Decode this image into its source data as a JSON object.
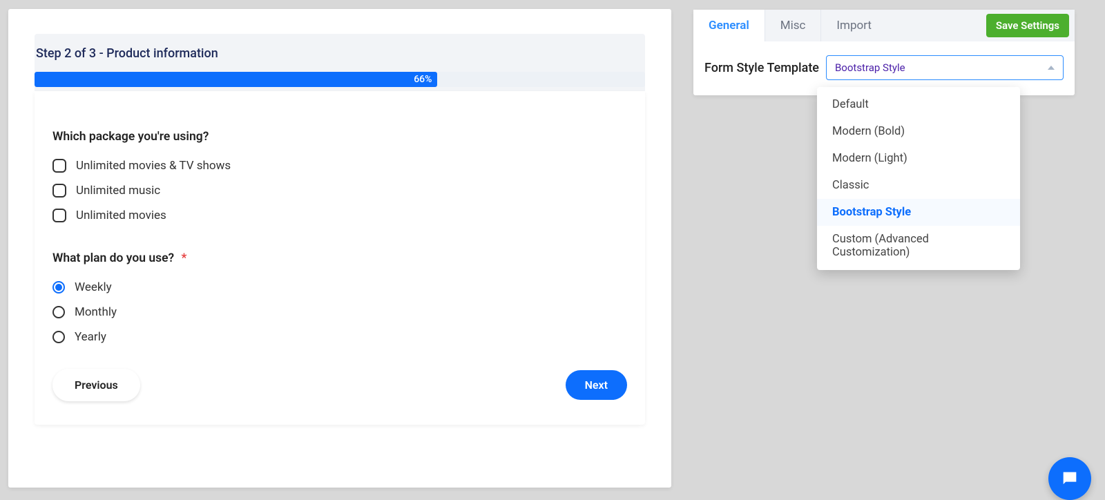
{
  "form": {
    "step_title": "Step 2 of 3 - Product information",
    "progress_text": "66%",
    "q1": {
      "label": "Which package you're using?",
      "options": [
        "Unlimited movies & TV shows",
        "Unlimited music",
        "Unlimited movies"
      ]
    },
    "q2": {
      "label": "What plan do you use?",
      "required_mark": "*",
      "options": [
        "Weekly",
        "Monthly",
        "Yearly"
      ],
      "selected": "Weekly"
    },
    "prev_label": "Previous",
    "next_label": "Next"
  },
  "settings": {
    "tabs": {
      "general": "General",
      "misc": "Misc",
      "import": "Import"
    },
    "save_label": "Save Settings",
    "template_label": "Form Style Template",
    "template_selected": "Bootstrap Style",
    "template_options": [
      "Default",
      "Modern (Bold)",
      "Modern (Light)",
      "Classic",
      "Bootstrap Style",
      "Custom (Advanced Customization)"
    ]
  }
}
